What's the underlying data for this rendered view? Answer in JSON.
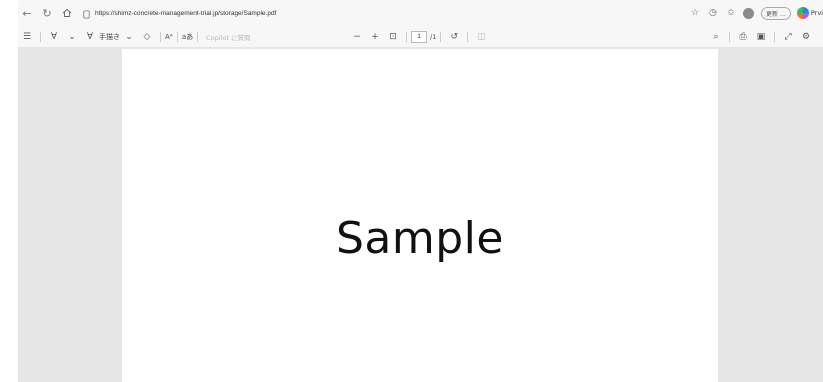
{
  "browser": {
    "url": "https://shimz-concrete-management-trial.jp/storage/Sample.pdf",
    "update_label": "更新 …",
    "profile_partial": "Prvi"
  },
  "toolbar": {
    "draw_label": "手描き",
    "read_aloud_label": "Aᴬ",
    "text_label": "aあ",
    "copilot_label": "Copilot に質問",
    "page_current": "1",
    "page_total": "/1"
  },
  "document": {
    "body_text": "Sample"
  }
}
